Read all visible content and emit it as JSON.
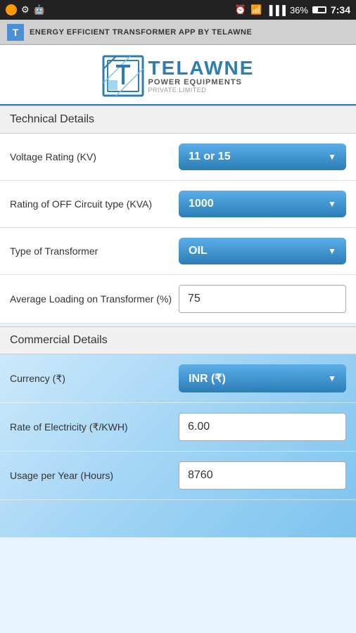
{
  "statusBar": {
    "time": "7:34",
    "battery": "36%",
    "icons": [
      "usb",
      "android",
      "alarm",
      "wifi",
      "signal",
      "battery"
    ]
  },
  "titleBar": {
    "text": "ENERGY EFFICIENT TRANSFORMER APP BY TELAWNE"
  },
  "logo": {
    "brand": "TELAWNE",
    "line1": "POWER EQUIPMENTS",
    "line2": "PRIVATE LIMITED"
  },
  "sections": {
    "technical": "Technical Details",
    "commercial": "Commercial Details"
  },
  "fields": {
    "voltageRating": {
      "label": "Voltage Rating (KV)",
      "value": "11 or 15"
    },
    "ratingOffCircuit": {
      "label": "Rating of OFF Circuit type (KVA)",
      "value": "1000"
    },
    "typeOfTransformer": {
      "label": "Type of Transformer",
      "value": "OIL"
    },
    "averageLoading": {
      "label": "Average Loading on Transformer (%)",
      "value": "75"
    },
    "currency": {
      "label": "Currency (₹)",
      "value": "INR (₹)"
    },
    "rateOfElectricity": {
      "label": "Rate of Electricity (₹/KWH)",
      "value": "6.00"
    },
    "usagePerYear": {
      "label": "Usage per Year (Hours)",
      "value": "8760"
    }
  }
}
